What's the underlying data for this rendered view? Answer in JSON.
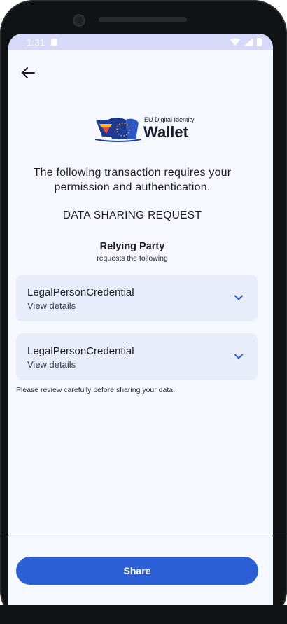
{
  "status_bar": {
    "time": "1:31"
  },
  "header": {
    "back_icon": "arrow-left-icon"
  },
  "logo": {
    "small_text": "EU Digital Identity",
    "big_text": "Wallet",
    "colors": {
      "navy": "#1f3a93",
      "red": "#e94b3c",
      "yellow": "#f5b82e"
    }
  },
  "intro": {
    "text": "The following transaction requires your permission and authentication."
  },
  "request": {
    "title": "DATA SHARING REQUEST",
    "relying_party": "Relying Party",
    "subtitle": "requests the following"
  },
  "credentials": [
    {
      "title": "LegalPersonCredential",
      "subtitle": "View details",
      "icon": "chevron-down-icon"
    },
    {
      "title": "LegalPersonCredential",
      "subtitle": "View details",
      "icon": "chevron-down-icon"
    }
  ],
  "note": "Please review carefully before sharing your data.",
  "share_button": {
    "label": "Share",
    "color": "#2c5fd6"
  }
}
